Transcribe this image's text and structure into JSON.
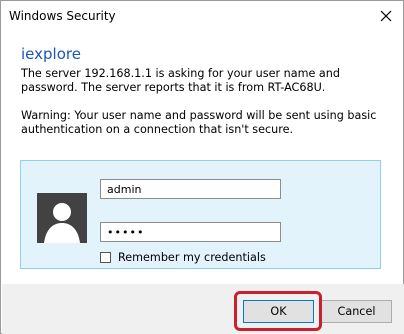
{
  "window": {
    "title": "Windows Security",
    "close_icon": "close-icon"
  },
  "dialog": {
    "app_name": "iexplore",
    "message": "The server 192.168.1.1 is asking for your user name and password. The server reports that it is from RT-AC68U.",
    "warning": "Warning: Your user name and password will be sent using basic authentication on a connection that isn't secure."
  },
  "credentials": {
    "avatar_icon": "user-silhouette-icon",
    "username_value": "admin",
    "password_value": "•••••",
    "remember_label": "Remember my credentials",
    "remember_checked": false,
    "panel_color": "#e3f3fb",
    "panel_border_color": "#8fd0ea"
  },
  "buttons": {
    "ok_label": "OK",
    "cancel_label": "Cancel",
    "highlight_color": "#c8202f"
  }
}
